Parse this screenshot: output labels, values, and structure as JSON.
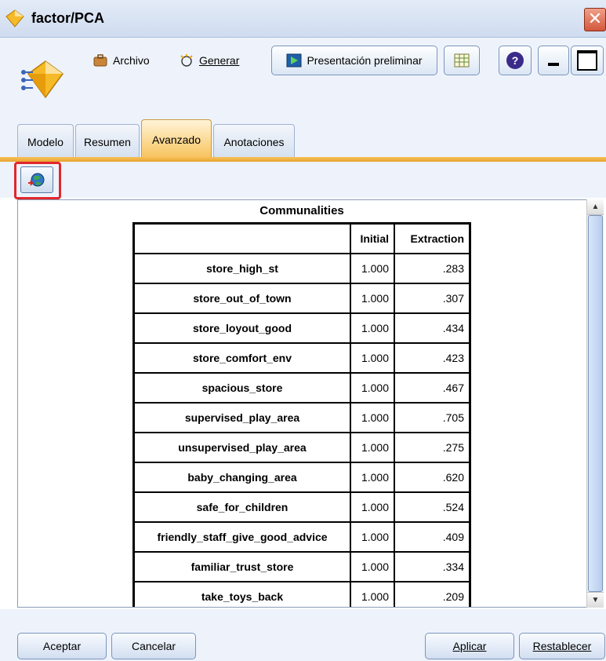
{
  "window": {
    "title": "factor/PCA",
    "close_glyph": "✕"
  },
  "toolbar": {
    "archivo_label": "Archivo",
    "generar_label": "Generar",
    "preview_label": "Presentación preliminar",
    "help_glyph": "?",
    "icons": {
      "archivo": "briefcase-icon",
      "generar": "generate-sparkle-icon",
      "preview": "play-preview-icon",
      "export": "export-table-icon",
      "help": "help-icon",
      "minimize": "minimize-icon",
      "maximize": "maximize-icon"
    }
  },
  "tabs": [
    {
      "label": "Modelo"
    },
    {
      "label": "Resumen"
    },
    {
      "label": "Avanzado",
      "active": true
    },
    {
      "label": "Anotaciones"
    }
  ],
  "advanced": {
    "launch_icon": "globe-launch-icon"
  },
  "pivot": {
    "title": "Communalities",
    "headers": [
      "",
      "Initial",
      "Extraction"
    ],
    "rows": [
      {
        "variable": "store_high_st",
        "initial": "1.000",
        "extraction": ".283"
      },
      {
        "variable": "store_out_of_town",
        "initial": "1.000",
        "extraction": ".307"
      },
      {
        "variable": "store_loyout_good",
        "initial": "1.000",
        "extraction": ".434"
      },
      {
        "variable": "store_comfort_env",
        "initial": "1.000",
        "extraction": ".423"
      },
      {
        "variable": "spacious_store",
        "initial": "1.000",
        "extraction": ".467"
      },
      {
        "variable": "supervised_play_area",
        "initial": "1.000",
        "extraction": ".705"
      },
      {
        "variable": "unsupervised_play_area",
        "initial": "1.000",
        "extraction": ".275"
      },
      {
        "variable": "baby_changing_area",
        "initial": "1.000",
        "extraction": ".620"
      },
      {
        "variable": "safe_for_children",
        "initial": "1.000",
        "extraction": ".524"
      },
      {
        "variable": "friendly_staff_give_good_advice",
        "initial": "1.000",
        "extraction": ".409"
      },
      {
        "variable": "familiar_trust_store",
        "initial": "1.000",
        "extraction": ".334"
      },
      {
        "variable": "take_toys_back",
        "initial": "1.000",
        "extraction": ".209"
      }
    ]
  },
  "buttons": {
    "aceptar": "Aceptar",
    "cancelar": "Cancelar",
    "aplicar": "Aplicar",
    "restablecer": "Restablecer"
  },
  "colors": {
    "active_tab": "#f7c25a",
    "highlight": "#e0272c",
    "chrome": "#eef3fb"
  }
}
